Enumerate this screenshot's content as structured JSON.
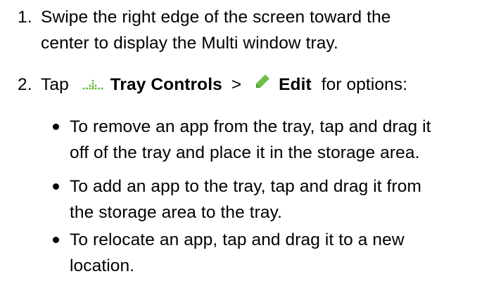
{
  "steps": [
    {
      "number": "1.",
      "lines": [
        "Swipe the right edge of the screen toward the",
        "center to display the Multi window tray."
      ]
    },
    {
      "number": "2.",
      "tap": "Tap",
      "tray_controls_icon": "dots-grid-icon",
      "tray_controls": "Tray Controls",
      "separator": ">",
      "edit_icon": "pencil-icon",
      "edit": "Edit",
      "suffix": "for options:"
    }
  ],
  "bullets": [
    {
      "lines": [
        "To remove an app from the tray, tap and drag it",
        "off of the tray and place it in the storage area."
      ]
    },
    {
      "lines": [
        "To add an app to the tray, tap and drag it from",
        "the storage area to the tray."
      ]
    },
    {
      "lines": [
        "To relocate an app, tap and drag it to a new",
        "location."
      ]
    }
  ],
  "colors": {
    "text": "#000000",
    "edit_icon": "#6fbe4a",
    "tray_icon": "#6fbe4a"
  }
}
